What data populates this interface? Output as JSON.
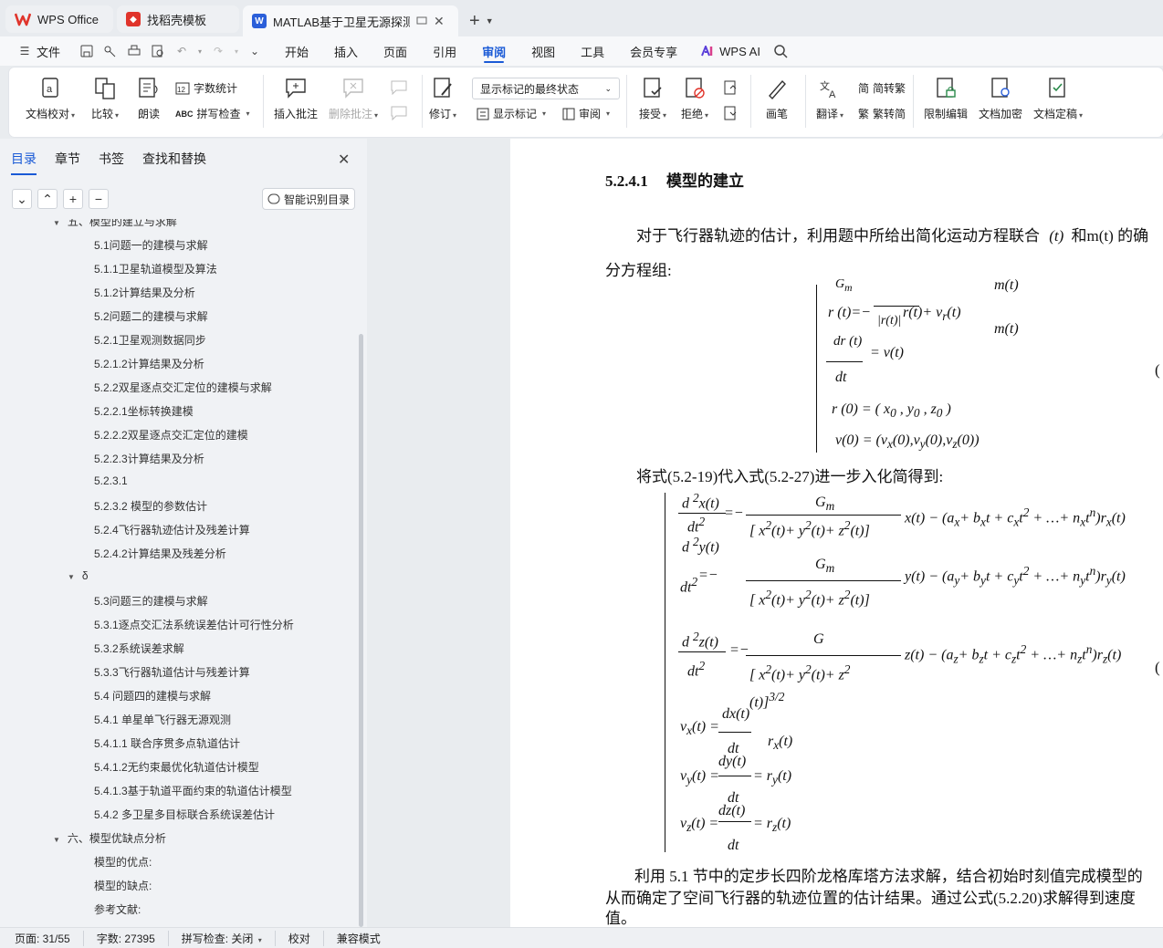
{
  "tabs": [
    {
      "label": "WPS Office",
      "color": "#e0342b"
    },
    {
      "label": "找稻壳模板",
      "color": "#e0342b"
    },
    {
      "label": "MATLAB基于卫星无源探测的空",
      "color": "#2b5fd9"
    }
  ],
  "menu": [
    "文件",
    "开始",
    "插入",
    "页面",
    "引用",
    "审阅",
    "视图",
    "工具",
    "会员专享",
    "WPS AI"
  ],
  "active_menu": "审阅",
  "ribbon": {
    "proof": "文档校对",
    "compare": "比较",
    "read": "朗读",
    "wordcount": "字数统计",
    "spellcheck": "拼写检查",
    "insert_comment": "插入批注",
    "delete_comment": "删除批注",
    "revise": "修订",
    "markup_state": "显示标记的最终状态",
    "show_markup": "显示标记",
    "review": "审阅",
    "accept": "接受",
    "reject": "拒绝",
    "pen": "画笔",
    "translate": "翻译",
    "to_simplified": "繁转简",
    "to_traditional": "简转繁",
    "restrict": "限制编辑",
    "encrypt": "文档加密",
    "finalize": "文档定稿"
  },
  "nav": {
    "tabs": [
      "目录",
      "章节",
      "书签",
      "查找和替换"
    ],
    "smart_toc": "智能识别目录",
    "items": [
      {
        "label": "五、模型的建立与求解",
        "level": 1,
        "expanded": true
      },
      {
        "label": "5.1问题一的建模与求解",
        "level": 3
      },
      {
        "label": "5.1.1卫星轨道模型及算法",
        "level": 3
      },
      {
        "label": "5.1.2计算结果及分析",
        "level": 3
      },
      {
        "label": "5.2问题二的建模与求解",
        "level": 3
      },
      {
        "label": "5.2.1卫星观测数据同步",
        "level": 3
      },
      {
        "label": "5.2.1.2计算结果及分析",
        "level": 3
      },
      {
        "label": "5.2.2双星逐点交汇定位的建模与求解",
        "level": 3
      },
      {
        "label": "5.2.2.1坐标转换建模",
        "level": 3
      },
      {
        "label": "5.2.2.2双星逐点交汇定位的建模",
        "level": 3
      },
      {
        "label": "5.2.2.3计算结果及分析",
        "level": 3
      },
      {
        "label": "5.2.3.1",
        "level": 3
      },
      {
        "label": "5.2.3.2 模型的参数估计",
        "level": 3
      },
      {
        "label": "5.2.4飞行器轨迹估计及残差计算",
        "level": 3
      },
      {
        "label": "5.2.4.2计算结果及残差分析",
        "level": 3
      },
      {
        "label": "δ",
        "level": 2,
        "expanded": true
      },
      {
        "label": "5.3问题三的建模与求解",
        "level": 3
      },
      {
        "label": "5.3.1逐点交汇法系统误差估计可行性分析",
        "level": 3
      },
      {
        "label": "5.3.2系统误差求解",
        "level": 3
      },
      {
        "label": "5.3.3飞行器轨道估计与残差计算",
        "level": 3
      },
      {
        "label": "5.4 问题四的建模与求解",
        "level": 3
      },
      {
        "label": "5.4.1 单星单飞行器无源观测",
        "level": 3
      },
      {
        "label": "5.4.1.1 联合序贯多点轨道估计",
        "level": 3
      },
      {
        "label": "5.4.1.2无约束最优化轨道估计模型",
        "level": 3
      },
      {
        "label": "5.4.1.3基于轨道平面约束的轨道估计模型",
        "level": 3
      },
      {
        "label": "5.4.2 多卫星多目标联合系统误差估计",
        "level": 3
      },
      {
        "label": "六、模型优缺点分析",
        "level": 1,
        "expanded": true
      },
      {
        "label": "模型的优点:",
        "level": 3
      },
      {
        "label": "模型的缺点:",
        "level": 3
      },
      {
        "label": "参考文献:",
        "level": 3
      }
    ]
  },
  "doc": {
    "heading_num": "5.2.4.1",
    "heading_text": "模型的建立",
    "para1": "对于飞行器轨迹的估计，利用题中所给出简化运动方程联合",
    "para1_tail": "和m(t) 的确",
    "para1b": "分方程组:",
    "para2": "将式(5.2-19)代入式(5.2-27)进一步入化简得到:",
    "para3": "利用 5.1 节中的定步长四阶龙格库塔方法求解，结合初始时刻值完成模型的",
    "para4": "从而确定了空间飞行器的轨迹位置的估计结果。通过公式(5.2.20)求解得到速度",
    "para5": "值。"
  },
  "status": {
    "page": "页面: 31/55",
    "words": "字数: 27395",
    "spell": "拼写检查: 关闭",
    "proof": "校对",
    "compat": "兼容模式"
  }
}
